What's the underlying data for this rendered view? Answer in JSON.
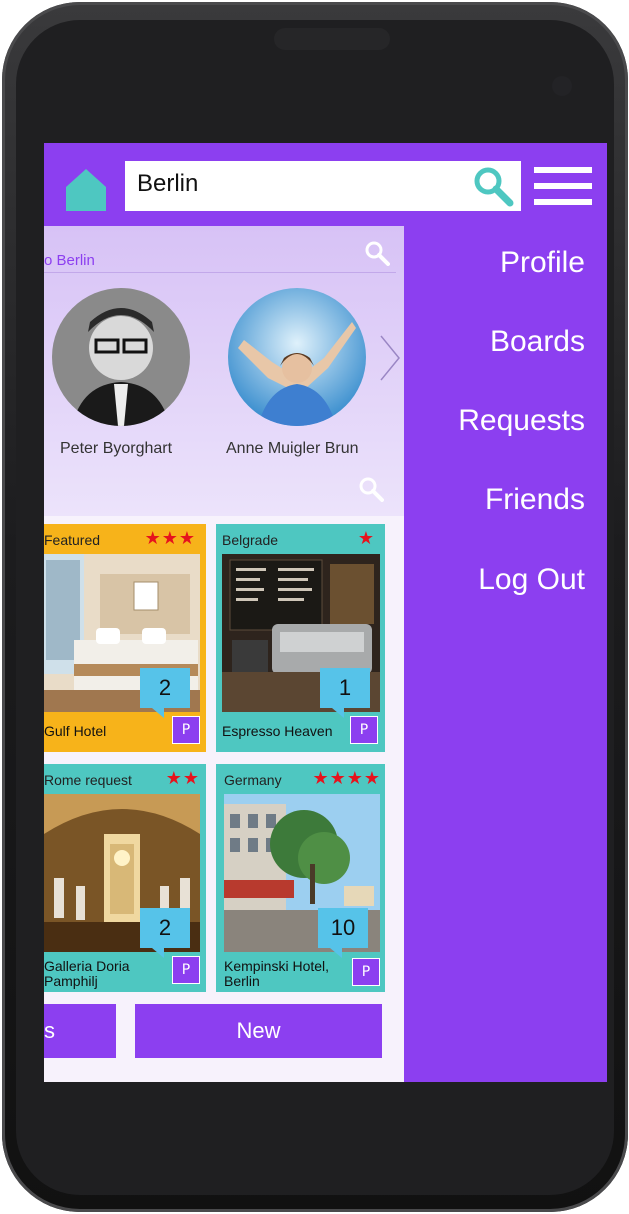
{
  "search": {
    "value": "Berlin"
  },
  "people_section": {
    "title": "o Berlin",
    "people": [
      {
        "name": "Peter Byorghart"
      },
      {
        "name": "Anne Muigler Brun"
      }
    ]
  },
  "cards": [
    {
      "title": "Featured",
      "stars": "★★★",
      "count": "2",
      "footer": "Gulf Hotel",
      "badge": "P"
    },
    {
      "title": "Belgrade",
      "stars": "★",
      "count": "1",
      "footer": "Espresso Heaven",
      "badge": "P"
    },
    {
      "title": "Rome request",
      "stars": "★★",
      "count": "2",
      "footer": "Galleria Doria Pamphilj",
      "badge": "P"
    },
    {
      "title": "Germany",
      "stars": "★★★★",
      "count": "10",
      "footer": "Kempinski Hotel, Berlin",
      "badge": "P"
    }
  ],
  "buttons": {
    "left_label": "s",
    "new_label": "New"
  },
  "menu": {
    "items": [
      {
        "label": "Profile"
      },
      {
        "label": "Boards"
      },
      {
        "label": "Requests"
      },
      {
        "label": "Friends"
      },
      {
        "label": "Log Out"
      }
    ]
  },
  "colors": {
    "accent_purple": "#8c3ff0",
    "teal": "#4ec7c1",
    "featured_yellow": "#f7b31a",
    "star_red": "#e6131d",
    "count_blue": "#56c3e9"
  },
  "icons": [
    "home-icon",
    "search-icon",
    "menu-icon",
    "chevron-right-icon",
    "star-icon"
  ]
}
